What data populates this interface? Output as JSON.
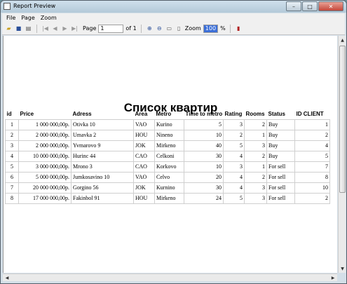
{
  "window": {
    "title": "Report Preview"
  },
  "menu": [
    "File",
    "Page",
    "Zoom"
  ],
  "toolbar": {
    "page_label": "Page",
    "page_value": "1",
    "page_of": "of 1",
    "zoom_label": "Zoom",
    "zoom_value": "100",
    "zoom_unit": "%"
  },
  "report": {
    "title": "Список квартир",
    "columns": [
      "id",
      "Price",
      "Adress",
      "Area",
      "Metro",
      "Time to metro",
      "Rating",
      "Rooms",
      "Status",
      "ID CLIENT"
    ],
    "rows": [
      [
        "1",
        "1 000 000,00р.",
        "Otivka 10",
        "VAO",
        "Kurino",
        "5",
        "3",
        "2",
        "Buy",
        "1"
      ],
      [
        "2",
        "2 000 000,00р.",
        "Umavka 2",
        "HOU",
        "Nineno",
        "10",
        "2",
        "1",
        "Buy",
        "2"
      ],
      [
        "3",
        "2 000 000,00р.",
        "Yvmarovo 9",
        "JOK",
        "Mirkeno",
        "40",
        "5",
        "3",
        "Buy",
        "4"
      ],
      [
        "4",
        "10 000 000,00р.",
        "Hurinc 44",
        "CAO",
        "Celkoni",
        "30",
        "4",
        "2",
        "Buy",
        "5"
      ],
      [
        "5",
        "3 000 000,00р.",
        "Mrono 3",
        "CAO",
        "Korkovo",
        "10",
        "3",
        "1",
        "For sell",
        "7"
      ],
      [
        "6",
        "5 000 000,00р.",
        "Jumkosavino 10",
        "VAO",
        "Celvo",
        "20",
        "4",
        "2",
        "For sell",
        "8"
      ],
      [
        "7",
        "20 000 000,00р.",
        "Gorgino 56",
        "JOK",
        "Kurnino",
        "30",
        "4",
        "3",
        "For sell",
        "10"
      ],
      [
        "8",
        "17 000 000,00р.",
        "Fakinbol 91",
        "HOU",
        "Mirkeno",
        "24",
        "5",
        "3",
        "For sell",
        "2"
      ]
    ]
  }
}
